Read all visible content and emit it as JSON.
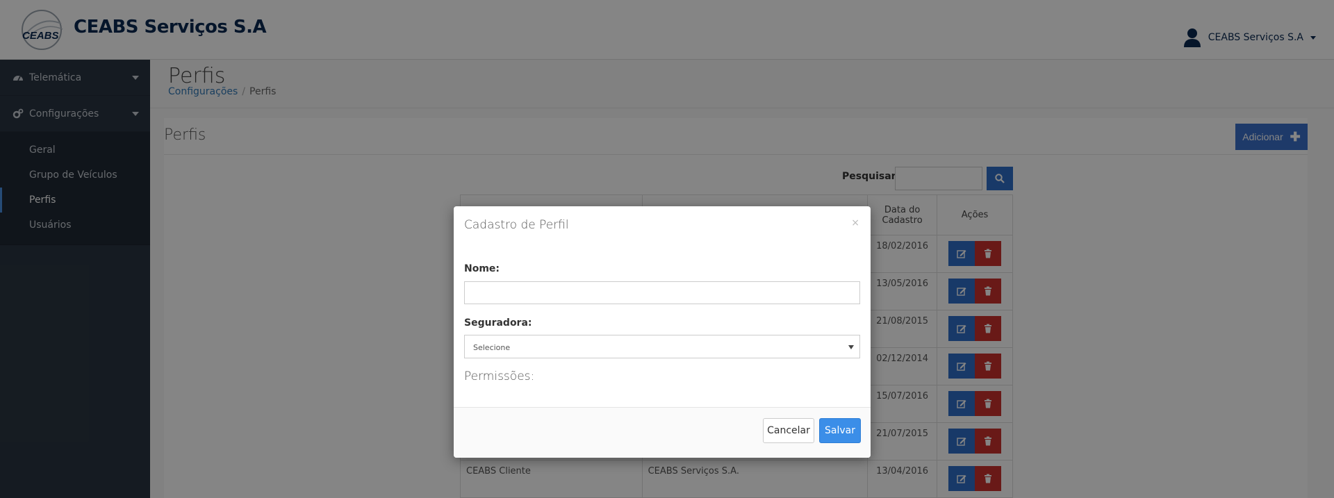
{
  "header": {
    "brand": "CEABS Serviços S.A",
    "logo_text": "CEABS",
    "user_name": "CEABS Serviços S.A"
  },
  "sidebar": {
    "items": [
      {
        "label": "Telemática",
        "icon": "dashboard-icon"
      },
      {
        "label": "Configurações",
        "icon": "cogs-icon"
      }
    ],
    "sub_items": [
      "Geral",
      "Grupo de Veículos",
      "Perfis",
      "Usuários"
    ],
    "active": "Perfis"
  },
  "page": {
    "title": "Perfis",
    "breadcrumb": {
      "parent": "Configurações",
      "separator": "/",
      "current": "Perfis"
    }
  },
  "panel": {
    "title": "Perfis",
    "add_label": "Adicionar",
    "search_label": "Pesquisar:"
  },
  "table": {
    "headers": {
      "date": "Data do Cadastro",
      "actions": "Ações"
    },
    "rows": [
      {
        "name": "",
        "insurer": "",
        "date": "18/02/2016"
      },
      {
        "name": "",
        "insurer": "",
        "date": "13/05/2016"
      },
      {
        "name": "",
        "insurer": "",
        "date": "21/08/2015"
      },
      {
        "name": "",
        "insurer": "",
        "date": "02/12/2014"
      },
      {
        "name": "",
        "insurer": "",
        "date": "15/07/2016"
      },
      {
        "name": "",
        "insurer": "",
        "date": "21/07/2015"
      },
      {
        "name": "CEABS Cliente",
        "insurer": "CEABS Serviços S.A.",
        "date": "13/04/2016"
      }
    ]
  },
  "modal": {
    "title": "Cadastro de Perfil",
    "close": "×",
    "name_label": "Nome:",
    "name_value": "",
    "insurer_label": "Seguradora:",
    "insurer_selected": "Selecione",
    "permissions_label": "Permissões:",
    "cancel_label": "Cancelar",
    "save_label": "Salvar"
  },
  "colors": {
    "sidebar": "#2a3541",
    "primary": "#2f6ec7",
    "danger": "#c9302c",
    "save": "#3b8ee8",
    "brand": "#0a2a52"
  }
}
